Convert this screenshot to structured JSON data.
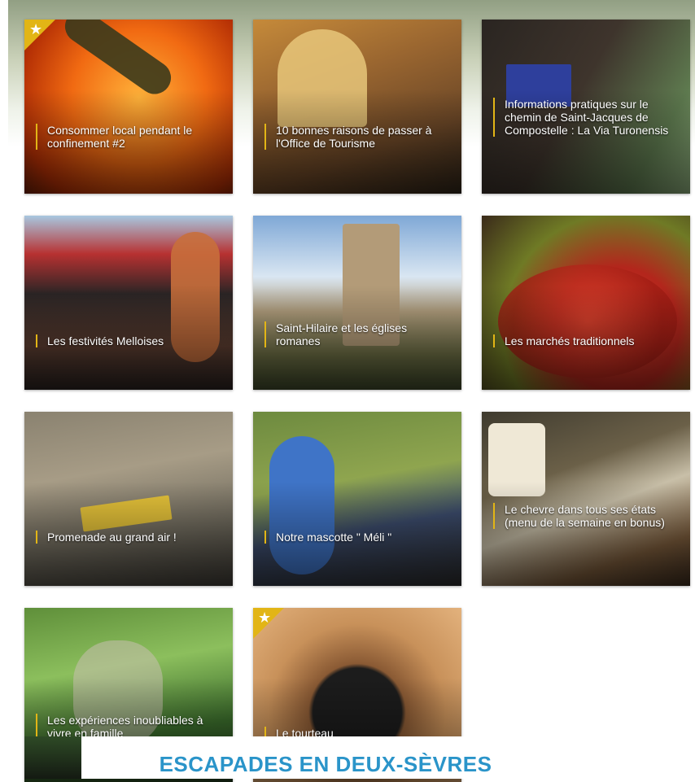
{
  "cards": [
    {
      "title": "Consommer local pendant le confinement #2",
      "featured": true
    },
    {
      "title": "10 bonnes raisons de passer à l'Office de Tourisme",
      "featured": false
    },
    {
      "title": "Informations pratiques sur le chemin de Saint-Jacques de Compostelle : La Via Turonensis",
      "featured": false
    },
    {
      "title": "Les festivités Melloises",
      "featured": false
    },
    {
      "title": "Saint-Hilaire et les églises romanes",
      "featured": false
    },
    {
      "title": "Les marchés traditionnels",
      "featured": false
    },
    {
      "title": "Promenade au grand air !",
      "featured": false
    },
    {
      "title": "Notre mascotte \" Méli \"",
      "featured": false
    },
    {
      "title": "Le chevre dans tous ses états (menu de la semaine en bonus)",
      "featured": false
    },
    {
      "title": "Les expériences inoubliables à vivre en famille",
      "featured": false
    },
    {
      "title": "Le tourteau",
      "featured": true
    }
  ],
  "banner": {
    "title": "ESCAPADES EN DEUX-SÈVRES"
  },
  "colors": {
    "accent": "#e2b516",
    "banner_text": "#2a94c9"
  },
  "icons": {
    "featured": "star-icon"
  }
}
